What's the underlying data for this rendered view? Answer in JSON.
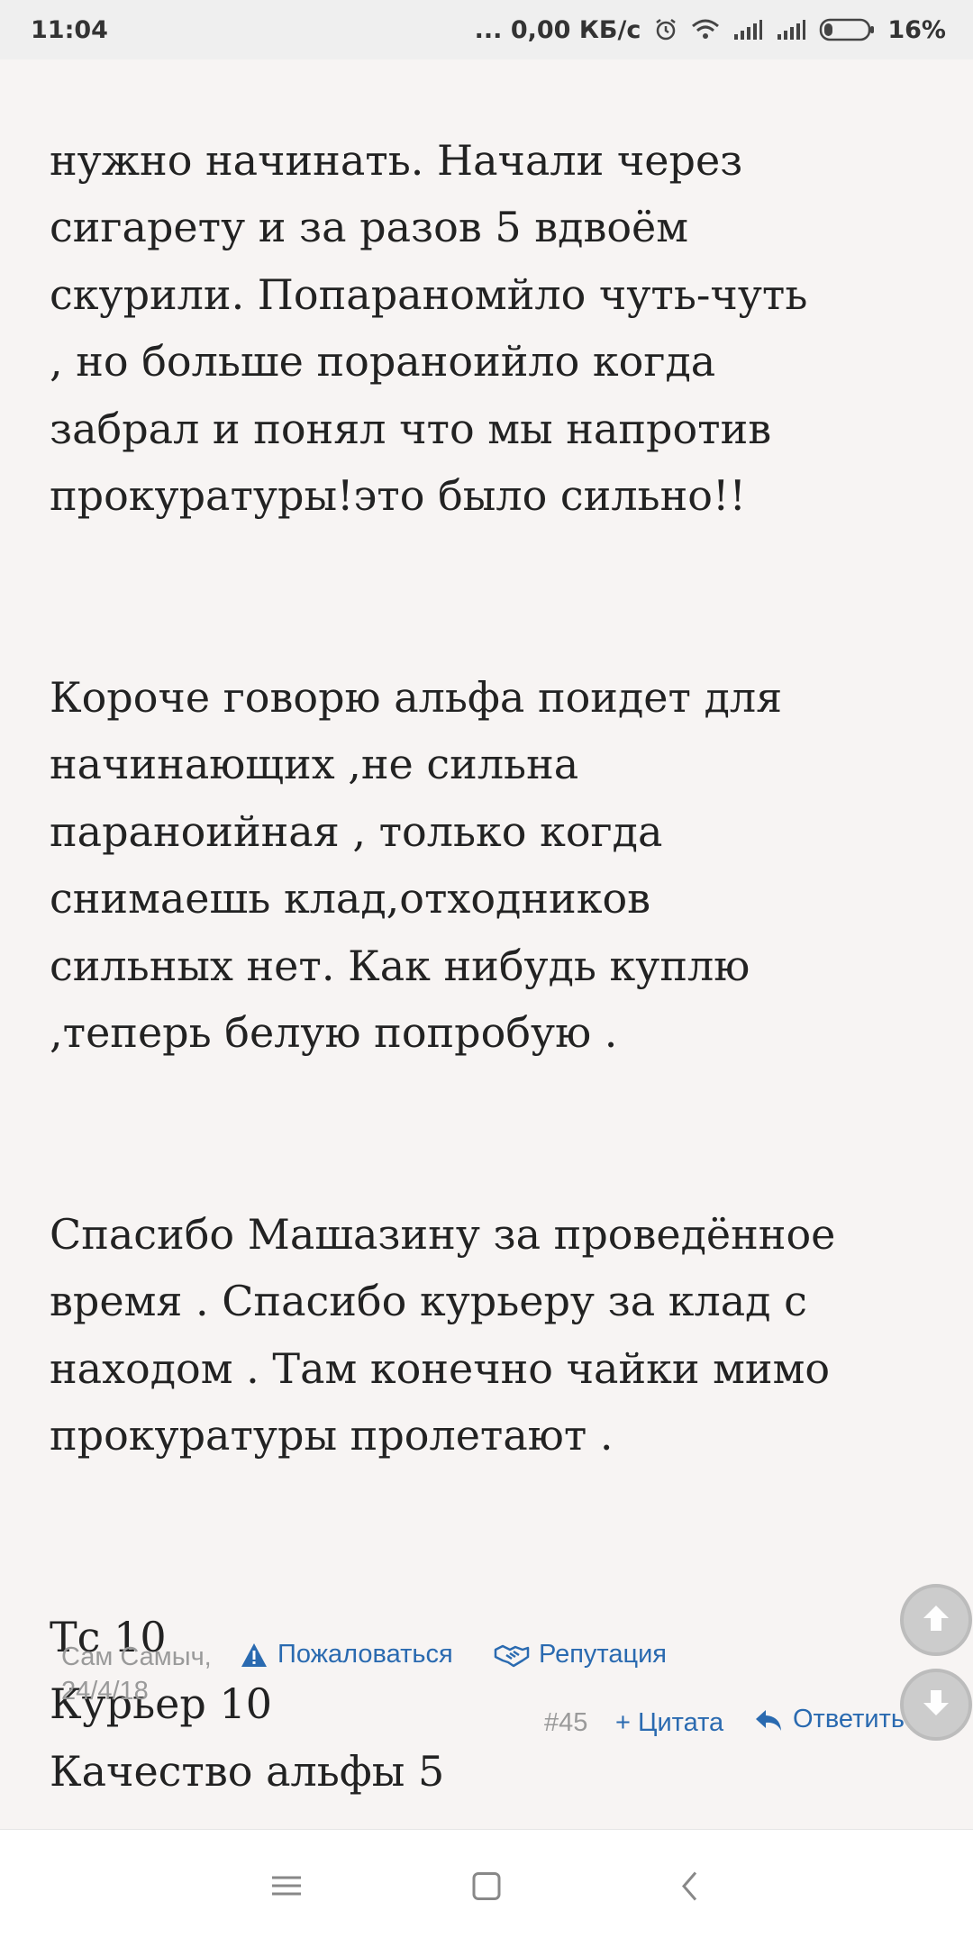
{
  "status_bar": {
    "time": "11:04",
    "network_speed": "... 0,00 КБ/с",
    "battery": "16%"
  },
  "post": {
    "paragraphs": [
      "нужно начинать. Начали через\nсигарету и за разов 5 вдвоём\nскурили. Попараномйло чуть-чуть\n, но больше пораноийло когда\nзабрал и понял что мы напротив\nпрокуратуры!это было сильно!!",
      "Короче говорю альфа поидет для\nначинающих ,не сильна\nпараноийная , только когда\nснимаешь клад,отходников\nсильных нет. Как нибудь куплю\n,теперь белую попробую .",
      "Спасибо Машазину за проведённое\nвремя . Спасибо курьеру за клад с\nнаходом . Там конечно чайки мимо\nпрокуратуры пролетают .\n\n",
      "Тс 10\nКурьер 10\nКачество альфы 5"
    ],
    "author": "Сам Самыч,",
    "date": "24/4/18",
    "report_label": "Пожаловаться",
    "reputation_label": "Репутация",
    "post_number": "#45",
    "quote_label": "+ Цитата",
    "reply_label": "Ответить"
  },
  "colors": {
    "link": "#2a6ab0",
    "muted": "#9a9a9a",
    "background": "#f7f4f3"
  },
  "icons": {
    "report": "warning-icon",
    "reputation": "handshake-icon",
    "reply": "reply-arrow-icon",
    "scroll_up": "arrow-up-icon",
    "scroll_down": "arrow-down-icon",
    "nav_menu": "menu-icon",
    "nav_home": "square-home-icon",
    "nav_back": "chevron-left-icon"
  }
}
